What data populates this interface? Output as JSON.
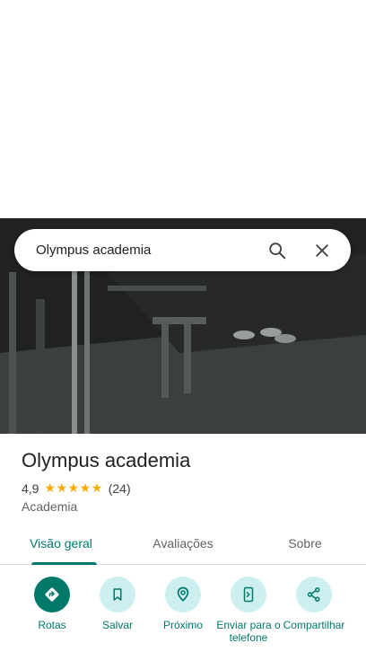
{
  "search": {
    "value": "Olympus academia"
  },
  "place": {
    "title": "Olympus academia",
    "rating": "4,9",
    "stars": "★★★★★",
    "reviews": "(24)",
    "category": "Academia"
  },
  "tabs": [
    {
      "label": "Visão geral"
    },
    {
      "label": "Avaliações"
    },
    {
      "label": "Sobre"
    }
  ],
  "actions": [
    {
      "label": "Rotas",
      "icon": "directions-icon"
    },
    {
      "label": "Salvar",
      "icon": "bookmark-icon"
    },
    {
      "label": "Próximo",
      "icon": "nearby-icon"
    },
    {
      "label": "Enviar para o telefone",
      "icon": "send-to-phone-icon"
    },
    {
      "label": "Compartilhar",
      "icon": "share-icon"
    }
  ],
  "colors": {
    "accent": "#00796b",
    "action_bg": "#cdeff0",
    "star": "#f9ab00"
  }
}
